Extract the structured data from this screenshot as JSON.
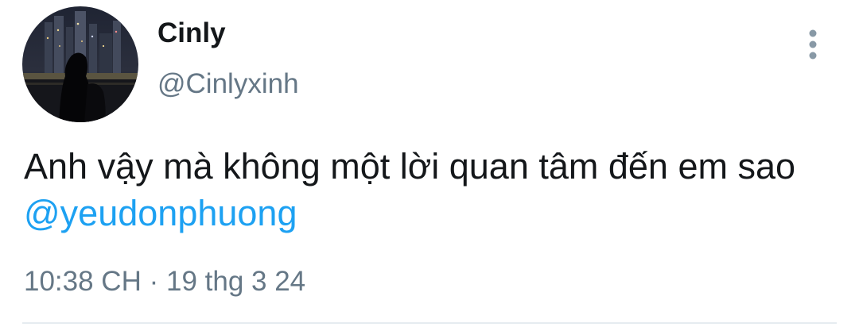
{
  "user": {
    "display_name": "Cinly",
    "handle": "@Cinlyxinh",
    "avatar_icon": "profile-photo-night-city-skyline"
  },
  "tweet": {
    "text": "Anh vậy mà không một lời quan tâm đến em sao ",
    "mention": "@yeudonphuong",
    "time": "10:38 CH",
    "separator": " · ",
    "date": "19 thg 3 24"
  },
  "icons": {
    "more": "more-vertical-icon"
  },
  "colors": {
    "text": "#14171a",
    "secondary": "#657786",
    "link": "#1da1f2",
    "divider": "#e6ecf0"
  }
}
